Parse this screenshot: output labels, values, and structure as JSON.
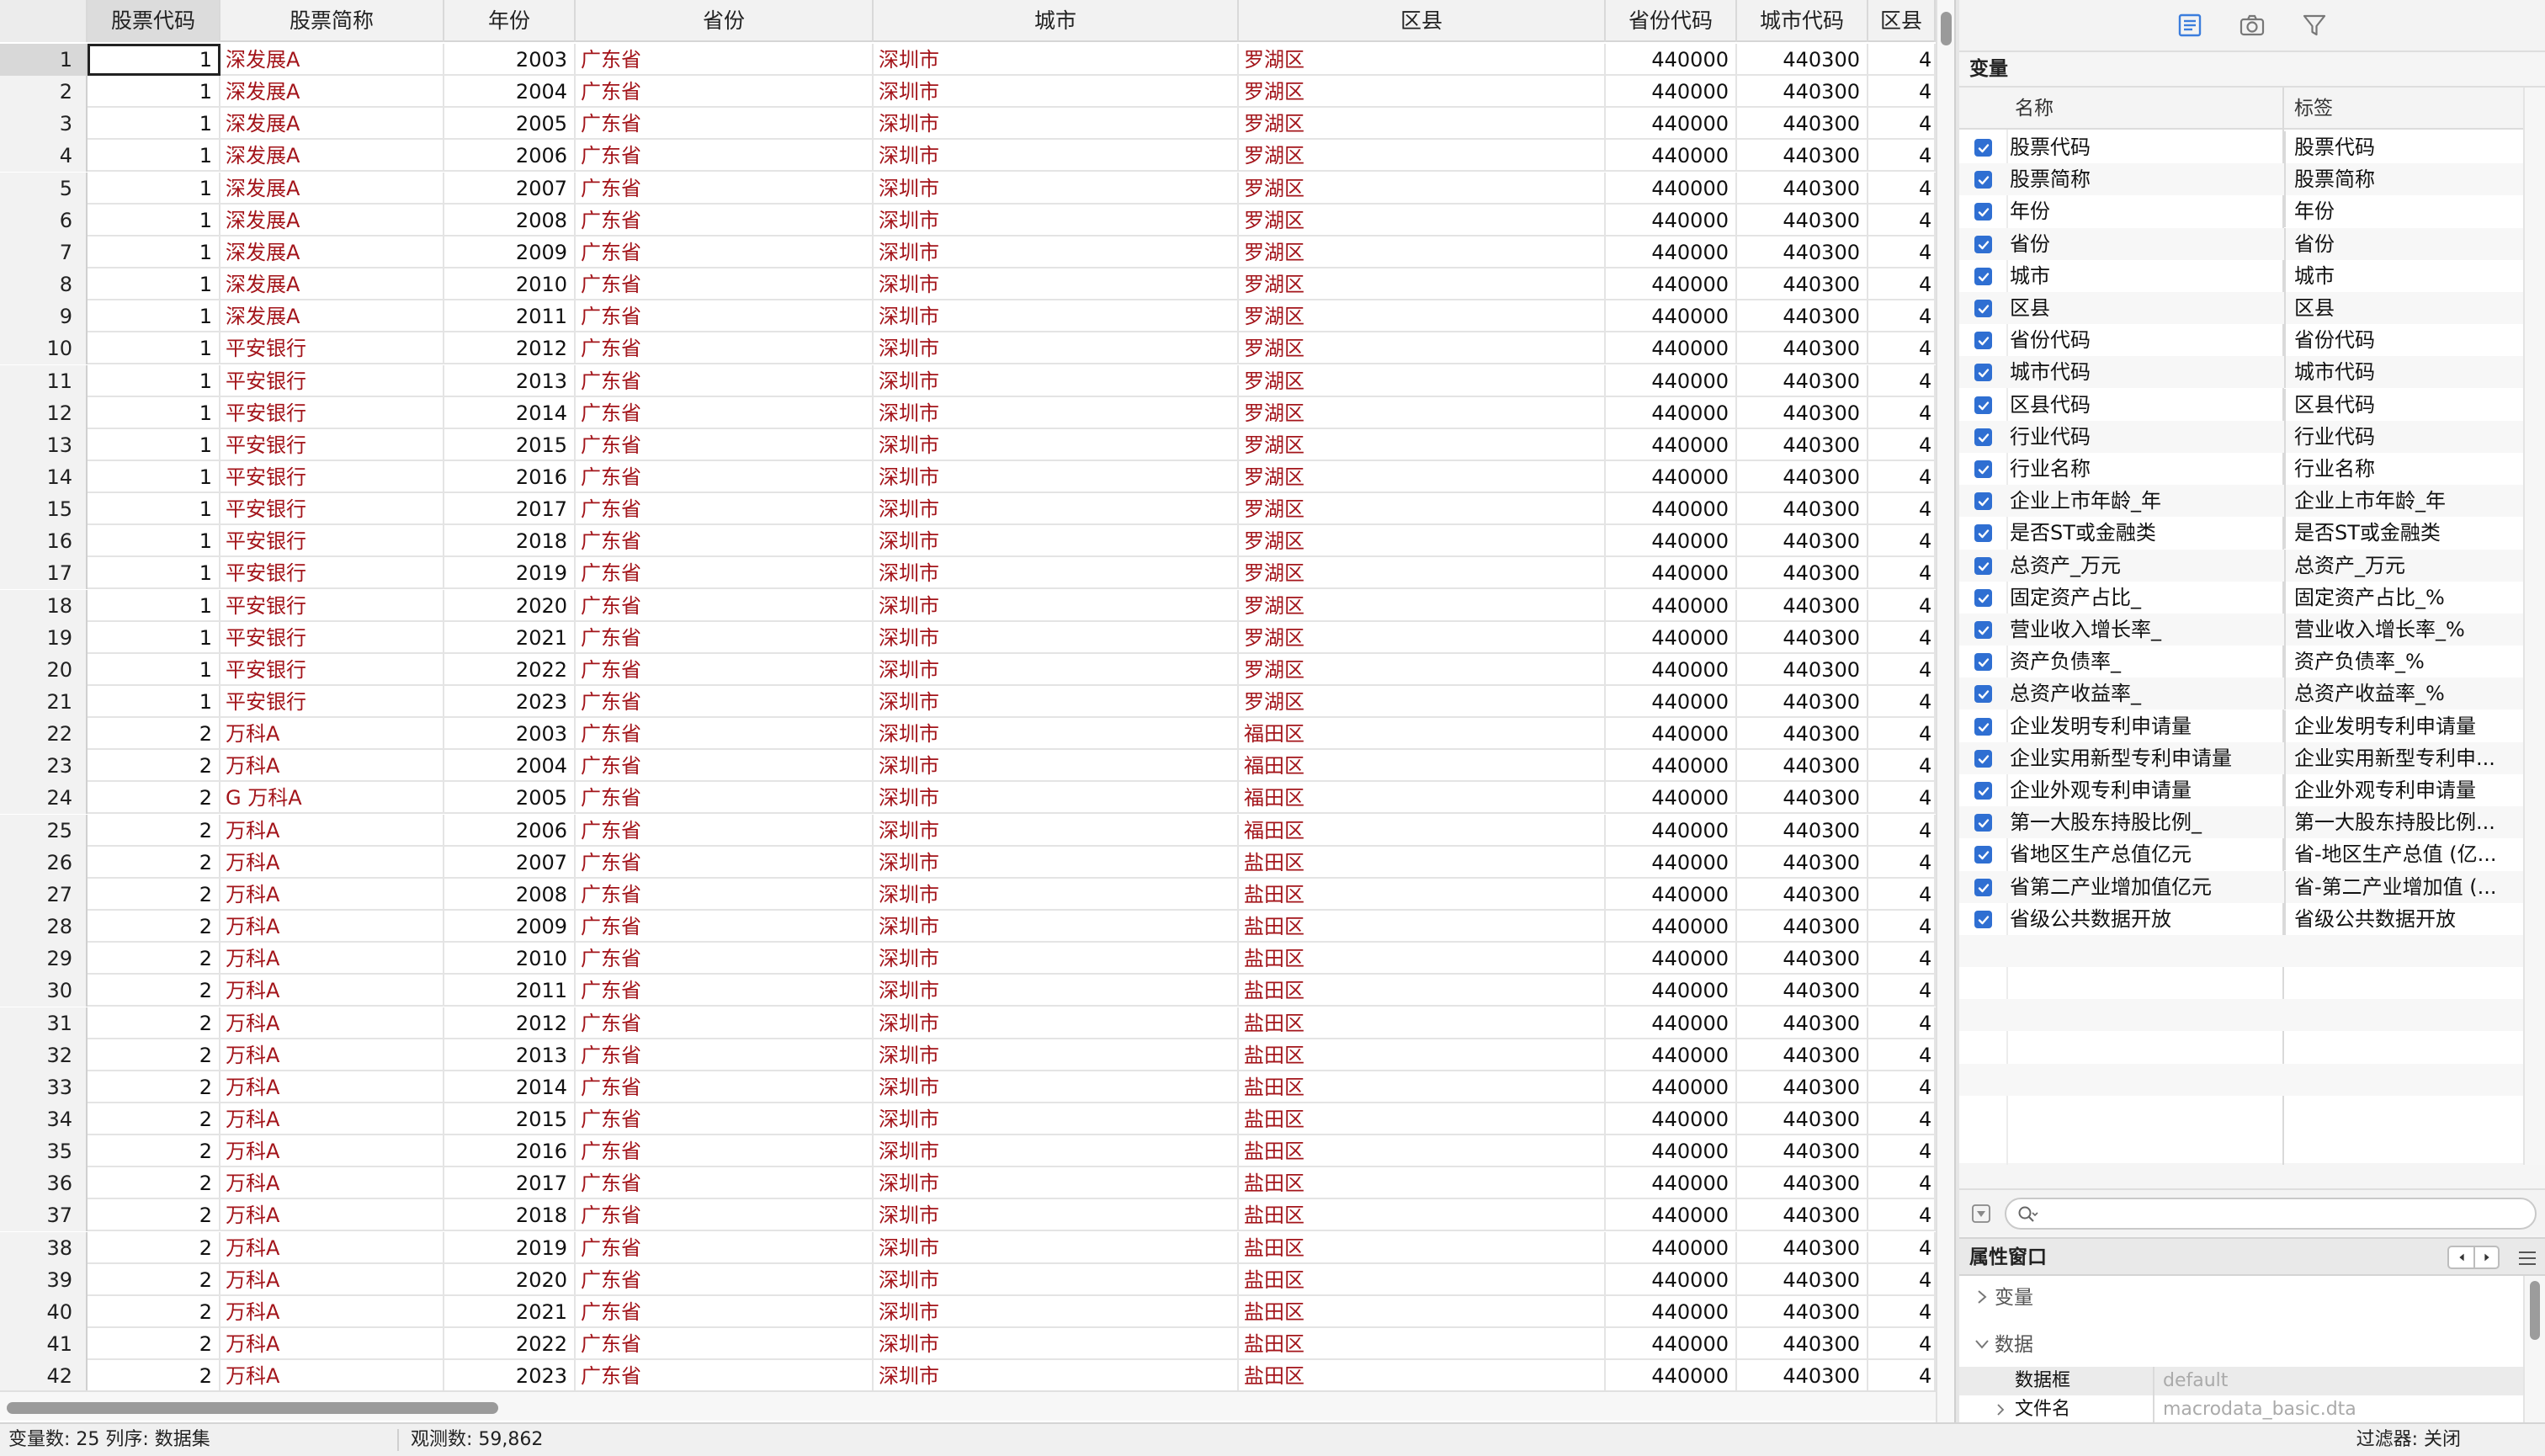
{
  "grid": {
    "columns": [
      "股票代码",
      "股票简称",
      "年份",
      "省份",
      "城市",
      "区县",
      "省份代码",
      "城市代码",
      "区县"
    ],
    "rows": [
      [
        1,
        "深发展A",
        2003,
        "广东省",
        "深圳市",
        "罗湖区",
        440000,
        440300
      ],
      [
        1,
        "深发展A",
        2004,
        "广东省",
        "深圳市",
        "罗湖区",
        440000,
        440300
      ],
      [
        1,
        "深发展A",
        2005,
        "广东省",
        "深圳市",
        "罗湖区",
        440000,
        440300
      ],
      [
        1,
        "深发展A",
        2006,
        "广东省",
        "深圳市",
        "罗湖区",
        440000,
        440300
      ],
      [
        1,
        "深发展A",
        2007,
        "广东省",
        "深圳市",
        "罗湖区",
        440000,
        440300
      ],
      [
        1,
        "深发展A",
        2008,
        "广东省",
        "深圳市",
        "罗湖区",
        440000,
        440300
      ],
      [
        1,
        "深发展A",
        2009,
        "广东省",
        "深圳市",
        "罗湖区",
        440000,
        440300
      ],
      [
        1,
        "深发展A",
        2010,
        "广东省",
        "深圳市",
        "罗湖区",
        440000,
        440300
      ],
      [
        1,
        "深发展A",
        2011,
        "广东省",
        "深圳市",
        "罗湖区",
        440000,
        440300
      ],
      [
        1,
        "平安银行",
        2012,
        "广东省",
        "深圳市",
        "罗湖区",
        440000,
        440300
      ],
      [
        1,
        "平安银行",
        2013,
        "广东省",
        "深圳市",
        "罗湖区",
        440000,
        440300
      ],
      [
        1,
        "平安银行",
        2014,
        "广东省",
        "深圳市",
        "罗湖区",
        440000,
        440300
      ],
      [
        1,
        "平安银行",
        2015,
        "广东省",
        "深圳市",
        "罗湖区",
        440000,
        440300
      ],
      [
        1,
        "平安银行",
        2016,
        "广东省",
        "深圳市",
        "罗湖区",
        440000,
        440300
      ],
      [
        1,
        "平安银行",
        2017,
        "广东省",
        "深圳市",
        "罗湖区",
        440000,
        440300
      ],
      [
        1,
        "平安银行",
        2018,
        "广东省",
        "深圳市",
        "罗湖区",
        440000,
        440300
      ],
      [
        1,
        "平安银行",
        2019,
        "广东省",
        "深圳市",
        "罗湖区",
        440000,
        440300
      ],
      [
        1,
        "平安银行",
        2020,
        "广东省",
        "深圳市",
        "罗湖区",
        440000,
        440300
      ],
      [
        1,
        "平安银行",
        2021,
        "广东省",
        "深圳市",
        "罗湖区",
        440000,
        440300
      ],
      [
        1,
        "平安银行",
        2022,
        "广东省",
        "深圳市",
        "罗湖区",
        440000,
        440300
      ],
      [
        1,
        "平安银行",
        2023,
        "广东省",
        "深圳市",
        "罗湖区",
        440000,
        440300
      ],
      [
        2,
        "万科A",
        2003,
        "广东省",
        "深圳市",
        "福田区",
        440000,
        440300
      ],
      [
        2,
        "万科A",
        2004,
        "广东省",
        "深圳市",
        "福田区",
        440000,
        440300
      ],
      [
        2,
        "G 万科A",
        2005,
        "广东省",
        "深圳市",
        "福田区",
        440000,
        440300
      ],
      [
        2,
        "万科A",
        2006,
        "广东省",
        "深圳市",
        "福田区",
        440000,
        440300
      ],
      [
        2,
        "万科A",
        2007,
        "广东省",
        "深圳市",
        "盐田区",
        440000,
        440300
      ],
      [
        2,
        "万科A",
        2008,
        "广东省",
        "深圳市",
        "盐田区",
        440000,
        440300
      ],
      [
        2,
        "万科A",
        2009,
        "广东省",
        "深圳市",
        "盐田区",
        440000,
        440300
      ],
      [
        2,
        "万科A",
        2010,
        "广东省",
        "深圳市",
        "盐田区",
        440000,
        440300
      ],
      [
        2,
        "万科A",
        2011,
        "广东省",
        "深圳市",
        "盐田区",
        440000,
        440300
      ],
      [
        2,
        "万科A",
        2012,
        "广东省",
        "深圳市",
        "盐田区",
        440000,
        440300
      ],
      [
        2,
        "万科A",
        2013,
        "广东省",
        "深圳市",
        "盐田区",
        440000,
        440300
      ],
      [
        2,
        "万科A",
        2014,
        "广东省",
        "深圳市",
        "盐田区",
        440000,
        440300
      ],
      [
        2,
        "万科A",
        2015,
        "广东省",
        "深圳市",
        "盐田区",
        440000,
        440300
      ],
      [
        2,
        "万科A",
        2016,
        "广东省",
        "深圳市",
        "盐田区",
        440000,
        440300
      ],
      [
        2,
        "万科A",
        2017,
        "广东省",
        "深圳市",
        "盐田区",
        440000,
        440300
      ],
      [
        2,
        "万科A",
        2018,
        "广东省",
        "深圳市",
        "盐田区",
        440000,
        440300
      ],
      [
        2,
        "万科A",
        2019,
        "广东省",
        "深圳市",
        "盐田区",
        440000,
        440300
      ],
      [
        2,
        "万科A",
        2020,
        "广东省",
        "深圳市",
        "盐田区",
        440000,
        440300
      ],
      [
        2,
        "万科A",
        2021,
        "广东省",
        "深圳市",
        "盐田区",
        440000,
        440300
      ],
      [
        2,
        "万科A",
        2022,
        "广东省",
        "深圳市",
        "盐田区",
        440000,
        440300
      ],
      [
        2,
        "万科A",
        2023,
        "广东省",
        "深圳市",
        "盐田区",
        440000,
        440300
      ]
    ],
    "partial_col_value": "4"
  },
  "panel": {
    "toolbar_icons": [
      "variables-list-icon",
      "camera-icon",
      "filter-icon"
    ],
    "variables_title": "变量",
    "col_name": "名称",
    "col_label": "标签",
    "variables": [
      {
        "name": "股票代码",
        "label": "股票代码"
      },
      {
        "name": "股票简称",
        "label": "股票简称"
      },
      {
        "name": "年份",
        "label": "年份"
      },
      {
        "name": "省份",
        "label": "省份"
      },
      {
        "name": "城市",
        "label": "城市"
      },
      {
        "name": "区县",
        "label": "区县"
      },
      {
        "name": "省份代码",
        "label": "省份代码"
      },
      {
        "name": "城市代码",
        "label": "城市代码"
      },
      {
        "name": "区县代码",
        "label": "区县代码"
      },
      {
        "name": "行业代码",
        "label": "行业代码"
      },
      {
        "name": "行业名称",
        "label": "行业名称"
      },
      {
        "name": "企业上市年龄_年",
        "label": "企业上市年龄_年"
      },
      {
        "name": "是否ST或金融类",
        "label": "是否ST或金融类"
      },
      {
        "name": "总资产_万元",
        "label": "总资产_万元"
      },
      {
        "name": "固定资产占比_",
        "label": "固定资产占比_%"
      },
      {
        "name": "营业收入增长率_",
        "label": "营业收入增长率_%"
      },
      {
        "name": "资产负债率_",
        "label": "资产负债率_%"
      },
      {
        "name": "总资产收益率_",
        "label": "总资产收益率_%"
      },
      {
        "name": "企业发明专利申请量",
        "label": "企业发明专利申请量"
      },
      {
        "name": "企业实用新型专利申请量",
        "label": "企业实用新型专利申..."
      },
      {
        "name": "企业外观专利申请量",
        "label": "企业外观专利申请量"
      },
      {
        "name": "第一大股东持股比例_",
        "label": "第一大股东持股比例..."
      },
      {
        "name": "省地区生产总值亿元",
        "label": "省-地区生产总值 (亿..."
      },
      {
        "name": "省第二产业增加值亿元",
        "label": "省-第二产业增加值 (..."
      },
      {
        "name": "省级公共数据开放",
        "label": "省级公共数据开放"
      }
    ],
    "search_placeholder": "",
    "properties_title": "属性窗口",
    "prop_variables": "变量",
    "prop_data": "数据",
    "prop_frame_key": "数据框",
    "prop_frame_value": "default",
    "prop_file_key": "文件名",
    "prop_file_value": "macrodata_basic.dta"
  },
  "status": {
    "vars_text": "变量数: 25  列序: 数据集",
    "obs_text": "观测数: 59,862",
    "filter_text": "过滤器: 关闭"
  },
  "colors": {
    "string_text": "#a3141a",
    "checkbox": "#2f6fd2",
    "active_icon": "#3b7ddd"
  }
}
